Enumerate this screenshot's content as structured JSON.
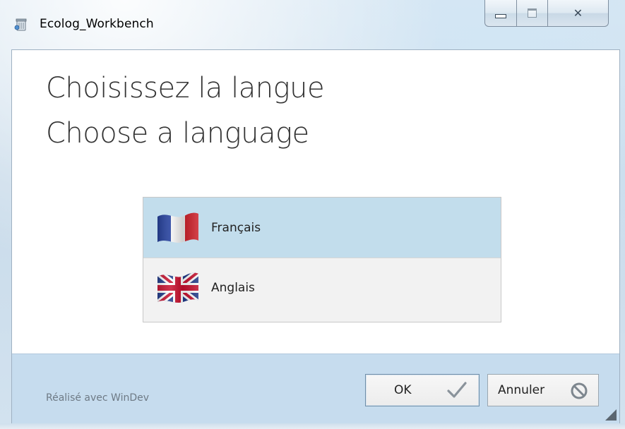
{
  "window": {
    "title": "Ecolog_Workbench",
    "minimize_glyph": "",
    "close_glyph": "✕"
  },
  "headings": {
    "french": "Choisissez la langue",
    "english": "Choose a language"
  },
  "languages": [
    {
      "label": "Français",
      "flag": "france-flag-icon",
      "selected": true
    },
    {
      "label": "Anglais",
      "flag": "uk-flag-icon",
      "selected": false
    }
  ],
  "footer": {
    "made_with": "Réalisé avec WinDev",
    "ok_label": "OK",
    "cancel_label": "Annuler"
  },
  "colors": {
    "selected_row": "#c2ddec",
    "footer_bg": "#c6dcee",
    "heading_text": "#333333"
  }
}
